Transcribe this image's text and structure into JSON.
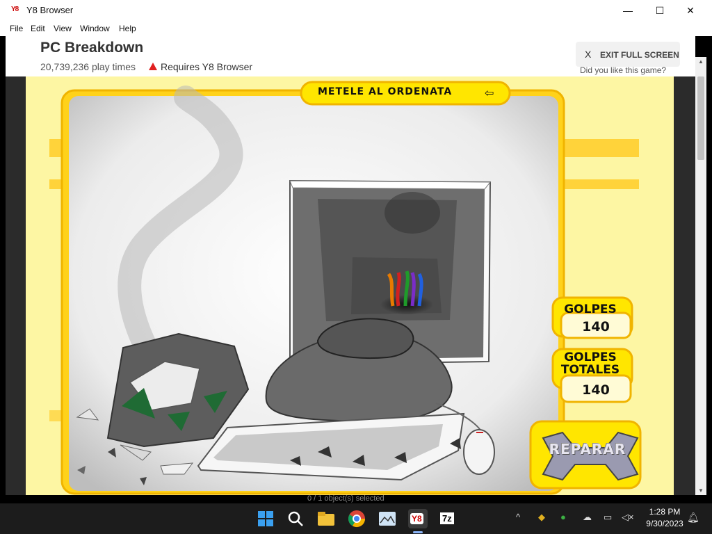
{
  "window": {
    "logo": "Y8",
    "title": "Y8 Browser",
    "controls": [
      "—",
      "☐",
      "✕"
    ]
  },
  "menu": [
    "File",
    "Edit",
    "View",
    "Window",
    "Help"
  ],
  "page": {
    "game_title": "PC Breakdown",
    "play_times": "20,739,236 play times",
    "requires": "Requires Y8 Browser",
    "exit_x": "X",
    "exit_label": "EXIT FULL SCREEN",
    "did_you_like": "Did you like this game?"
  },
  "game": {
    "banner": "METELE AL ORDENATA",
    "golpes_label": "GOLPES",
    "golpes_value": "140",
    "golpes_totales_label": "GOLPES TOTALES",
    "golpes_totales_value": "140",
    "repair_button": "REPARAR"
  },
  "status_text": "0 / 1 object(s) selected",
  "taskbar": {
    "apps": [
      "windows-start-icon",
      "search-icon",
      "file-explorer-icon",
      "chrome-icon",
      "photos-icon",
      "y8-browser-icon",
      "7zip-icon"
    ],
    "y8_label": "Y8",
    "zip_label": "7z",
    "time": "1:28 PM",
    "date": "9/30/2023"
  },
  "colors": {
    "game_bg": "#fdf6a3",
    "frame_yellow": "#ffd21a",
    "frame_orange": "#f0b400",
    "taskbar": "#1c1c1c"
  }
}
